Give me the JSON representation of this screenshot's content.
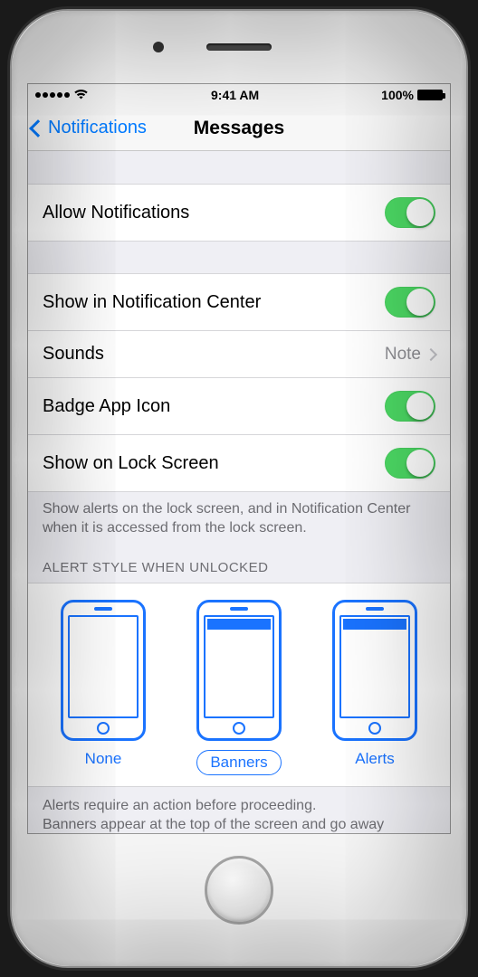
{
  "status": {
    "time": "9:41 AM",
    "battery_pct": "100%"
  },
  "nav": {
    "back_label": "Notifications",
    "title": "Messages"
  },
  "rows": {
    "allow": "Allow Notifications",
    "show_nc": "Show in Notification Center",
    "sounds_label": "Sounds",
    "sounds_value": "Note",
    "badge": "Badge App Icon",
    "lock": "Show on Lock Screen"
  },
  "footer1": "Show alerts on the lock screen, and in Notification Center when it is accessed from the lock screen.",
  "section_header": "ALERT STYLE WHEN UNLOCKED",
  "styles": {
    "none": "None",
    "banners": "Banners",
    "alerts": "Alerts"
  },
  "footer2": "Alerts require an action before proceeding.\nBanners appear at the top of the screen and go away",
  "toggles": {
    "allow": true,
    "show_nc": true,
    "badge": true,
    "lock": true
  },
  "colors": {
    "ios_blue": "#007aff",
    "toggle_green": "#4cd964",
    "group_bg": "#efeff4"
  }
}
